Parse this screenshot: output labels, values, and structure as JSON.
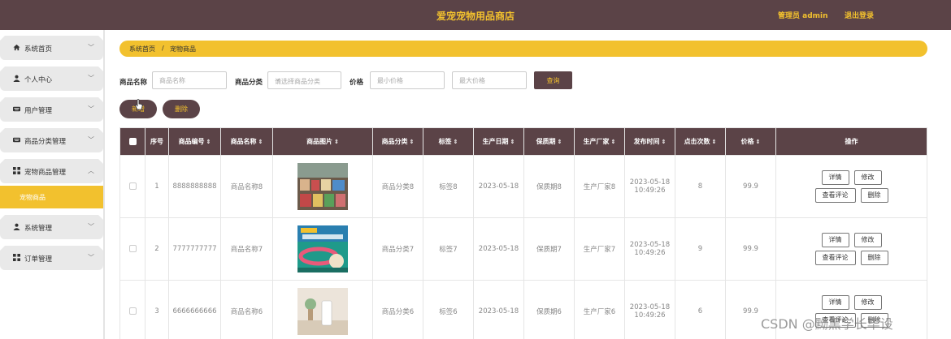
{
  "header": {
    "title": "爱宠宠物用品商店",
    "admin": "管理员 admin",
    "logout": "退出登录"
  },
  "sidebar": {
    "items": [
      {
        "label": "系统首页",
        "icon": "home-icon"
      },
      {
        "label": "个人中心",
        "icon": "user-icon"
      },
      {
        "label": "用户管理",
        "icon": "keyboard-icon"
      },
      {
        "label": "商品分类管理",
        "icon": "keyboard-icon"
      },
      {
        "label": "宠物商品管理",
        "icon": "grid-icon",
        "expanded": true
      },
      {
        "label": "系统管理",
        "icon": "user-icon"
      },
      {
        "label": "订单管理",
        "icon": "grid-icon"
      }
    ],
    "sub_active": "宠物商品"
  },
  "breadcrumb": {
    "home": "系统首页",
    "separator": "/",
    "current": "宠物商品"
  },
  "search": {
    "name_label": "商品名称",
    "name_placeholder": "商品名称",
    "category_label": "商品分类",
    "category_placeholder": "请选择商品分类",
    "price_label": "价格",
    "min_placeholder": "最小价格",
    "max_placeholder": "最大价格",
    "query_button": "查询"
  },
  "actions": {
    "add": "新增",
    "delete": "删除"
  },
  "table": {
    "headers": [
      "序号",
      "商品编号",
      "商品名称",
      "商品图片",
      "商品分类",
      "标签",
      "生产日期",
      "保质期",
      "生产厂家",
      "发布时间",
      "点击次数",
      "价格",
      "操作"
    ],
    "rows": [
      {
        "index": "1",
        "code": "8888888888",
        "name": "商品名称8",
        "category": "商品分类8",
        "tag": "标签8",
        "date": "2023-05-18",
        "shelf": "保质期8",
        "maker": "生产厂家8",
        "pub_date": "2023-05-18",
        "pub_time": "10:49:26",
        "clicks": "8",
        "price": "99.9"
      },
      {
        "index": "2",
        "code": "7777777777",
        "name": "商品名称7",
        "category": "商品分类7",
        "tag": "标签7",
        "date": "2023-05-18",
        "shelf": "保质期7",
        "maker": "生产厂家7",
        "pub_date": "2023-05-18",
        "pub_time": "10:49:26",
        "clicks": "9",
        "price": "99.9"
      },
      {
        "index": "3",
        "code": "6666666666",
        "name": "商品名称6",
        "category": "商品分类6",
        "tag": "标签6",
        "date": "2023-05-18",
        "shelf": "保质期6",
        "maker": "生产厂家6",
        "pub_date": "2023-05-18",
        "pub_time": "10:49:26",
        "clicks": "6",
        "price": "99.9"
      }
    ],
    "ops": {
      "detail": "详情",
      "edit": "修改",
      "review": "查看评论",
      "delete": "删除"
    }
  },
  "watermark": "CSDN @黝黑学长毕设",
  "colors": {
    "brand": "#5b4347",
    "accent": "#f2c12e"
  }
}
